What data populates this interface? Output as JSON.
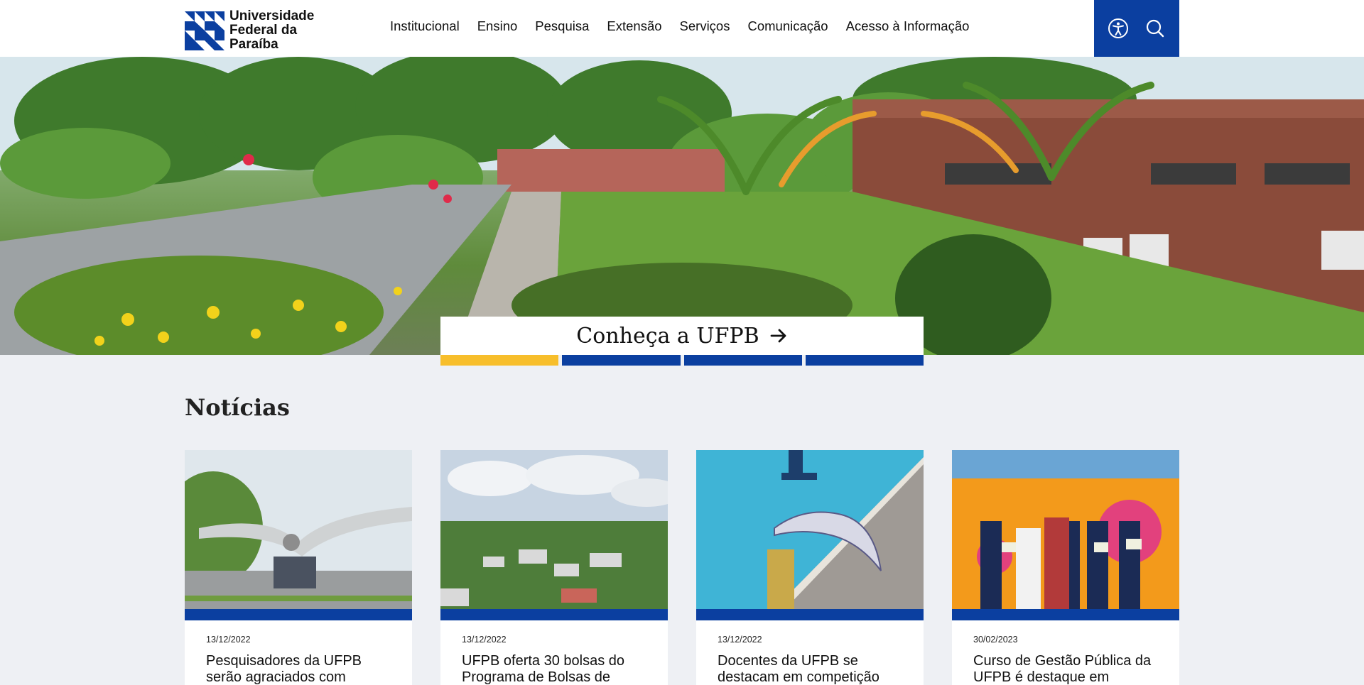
{
  "header": {
    "logo_lines": [
      "Universidade",
      "Federal da",
      "Paraíba"
    ],
    "nav": [
      "Institucional",
      "Ensino",
      "Pesquisa",
      "Extensão",
      "Serviços",
      "Comunicação",
      "Acesso à Informação"
    ],
    "tools": {
      "accessibility_icon": "accessibility-icon",
      "search_icon": "search-icon"
    }
  },
  "hero": {
    "cta_label": "Conheça a UFPB",
    "cta_icon": "arrow-right-icon",
    "slides": 4,
    "active_slide": 1
  },
  "news": {
    "title": "Notícias",
    "items": [
      {
        "date": "13/12/2022",
        "title": "Pesquisadores da UFPB serão agraciados com"
      },
      {
        "date": "13/12/2022",
        "title": "UFPB oferta 30 bolsas do Programa de Bolsas de"
      },
      {
        "date": "13/12/2022",
        "title": "Docentes da UFPB se destacam em competição"
      },
      {
        "date": "30/02/2023",
        "title": "Curso de Gestão Pública da UFPB é destaque em"
      }
    ]
  },
  "colors": {
    "brand_blue": "#0b3fa0",
    "accent_yellow": "#f7be2b",
    "background": "#eef0f4"
  }
}
